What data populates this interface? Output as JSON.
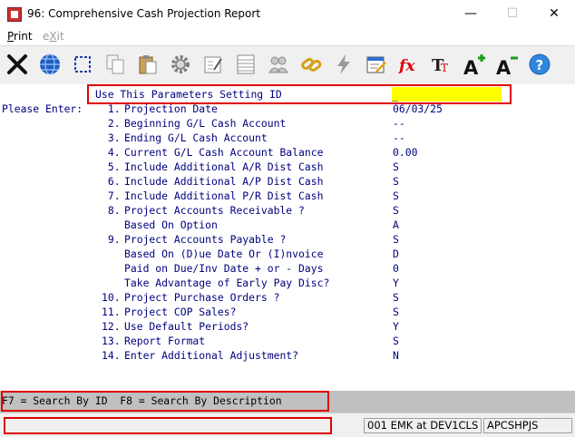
{
  "window": {
    "title": "96: Comprehensive Cash Projection Report",
    "minimize_glyph": "—",
    "maximize_glyph": "☐",
    "close_glyph": "✕"
  },
  "menu": {
    "print_first": "P",
    "print_rest": "rint",
    "exit_first": "e",
    "exit_ul": "X",
    "exit_rest": "it"
  },
  "toolbar_icons": [
    "close-x-icon",
    "globe-icon",
    "select-box-icon",
    "copy-pages-icon",
    "paste-clipboard-icon",
    "gear-icon",
    "edit-form-icon",
    "list-table-icon",
    "users-icon",
    "link-chain-icon",
    "lightning-icon",
    "calendar-edit-icon",
    "function-fx-icon",
    "text-font-icon",
    "font-increase-icon",
    "font-decrease-icon",
    "help-icon"
  ],
  "form": {
    "setting_label": "Use This Parameters Setting ID",
    "setting_value": "_",
    "please_enter": "Please Enter:",
    "rows": [
      {
        "num": " 1.",
        "label": "Projection Date",
        "value": "06/03/25"
      },
      {
        "num": " 2.",
        "label": "Beginning G/L Cash Account",
        "value": "--"
      },
      {
        "num": " 3.",
        "label": "Ending G/L Cash Account",
        "value": "--"
      },
      {
        "num": " 4.",
        "label": "Current G/L Cash Account Balance",
        "value": "0.00"
      },
      {
        "num": " 5.",
        "label": "Include Additional A/R Dist Cash",
        "value": "S"
      },
      {
        "num": " 6.",
        "label": "Include Additional A/P Dist Cash",
        "value": "S"
      },
      {
        "num": " 7.",
        "label": "Include Additional P/R Dist Cash",
        "value": "S"
      },
      {
        "num": " 8.",
        "label": "Project Accounts Receivable ?",
        "value": "S"
      },
      {
        "num": "",
        "label": "Based On Option",
        "value": "A"
      },
      {
        "num": " 9.",
        "label": "Project Accounts Payable ?",
        "value": "S"
      },
      {
        "num": "",
        "label": "Based On (D)ue Date Or (I)nvoice",
        "value": "D"
      },
      {
        "num": "",
        "label": "Paid on Due/Inv Date + or - Days",
        "value": "0"
      },
      {
        "num": "",
        "label": "Take Advantage of Early Pay Disc?",
        "value": "Y"
      },
      {
        "num": "10.",
        "label": "Project Purchase Orders ?",
        "value": "S"
      },
      {
        "num": "11.",
        "label": "Project COP Sales?",
        "value": "S"
      },
      {
        "num": "12.",
        "label": "Use Default Periods?",
        "value": "Y"
      },
      {
        "num": "13.",
        "label": "Report Format",
        "value": "S"
      },
      {
        "num": "14.",
        "label": "Enter Additional Adjustment?",
        "value": "N"
      }
    ]
  },
  "fkeys": {
    "text": "F7 = Search By ID  F8 = Search By Description"
  },
  "status": {
    "pane1": "",
    "pane2": "001 EMK at DEV1CLS",
    "pane3": "APCSHPJS"
  },
  "colors": {
    "field_text": "#000080",
    "highlight_field": "#ffff00",
    "annotation_border": "#e00000"
  }
}
